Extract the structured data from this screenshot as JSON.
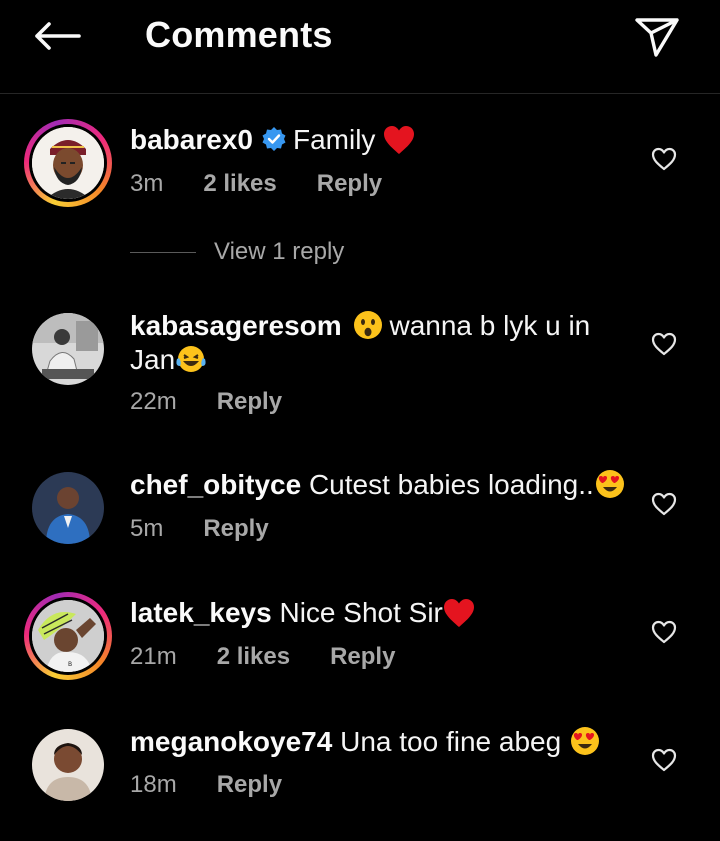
{
  "header": {
    "title": "Comments",
    "back_icon": "arrow-left-icon",
    "share_icon": "send-icon"
  },
  "comments": [
    {
      "username": "babarex0",
      "verified": true,
      "text": "Family",
      "emoji": "red-heart",
      "time": "3m",
      "likes": "2 likes",
      "reply": "Reply",
      "view_replies": "View 1 reply"
    },
    {
      "username": "kabasageresom",
      "text_part1": "wanna b lyk u in",
      "text_part2": "Jan",
      "emoji1": "astonished-face",
      "emoji2": "laughing-tears-face",
      "time": "22m",
      "reply": "Reply"
    },
    {
      "username": "chef_obityce",
      "text": "Cutest babies loading..",
      "emoji": "heart-eyes-face",
      "time": "5m",
      "reply": "Reply"
    },
    {
      "username": "latek_keys",
      "text": "Nice Shot Sir",
      "emoji": "red-heart",
      "time": "21m",
      "likes": "2 likes",
      "reply": "Reply"
    },
    {
      "username": "meganokoye74",
      "text": "Una too fine abeg",
      "emoji": "heart-eyes-face",
      "time": "18m",
      "reply": "Reply"
    }
  ],
  "colors": {
    "background": "#000000",
    "text": "#f5f5f5",
    "secondary": "#a8a8a8",
    "verified": "#3797f0",
    "heart": "#ed1c24"
  }
}
